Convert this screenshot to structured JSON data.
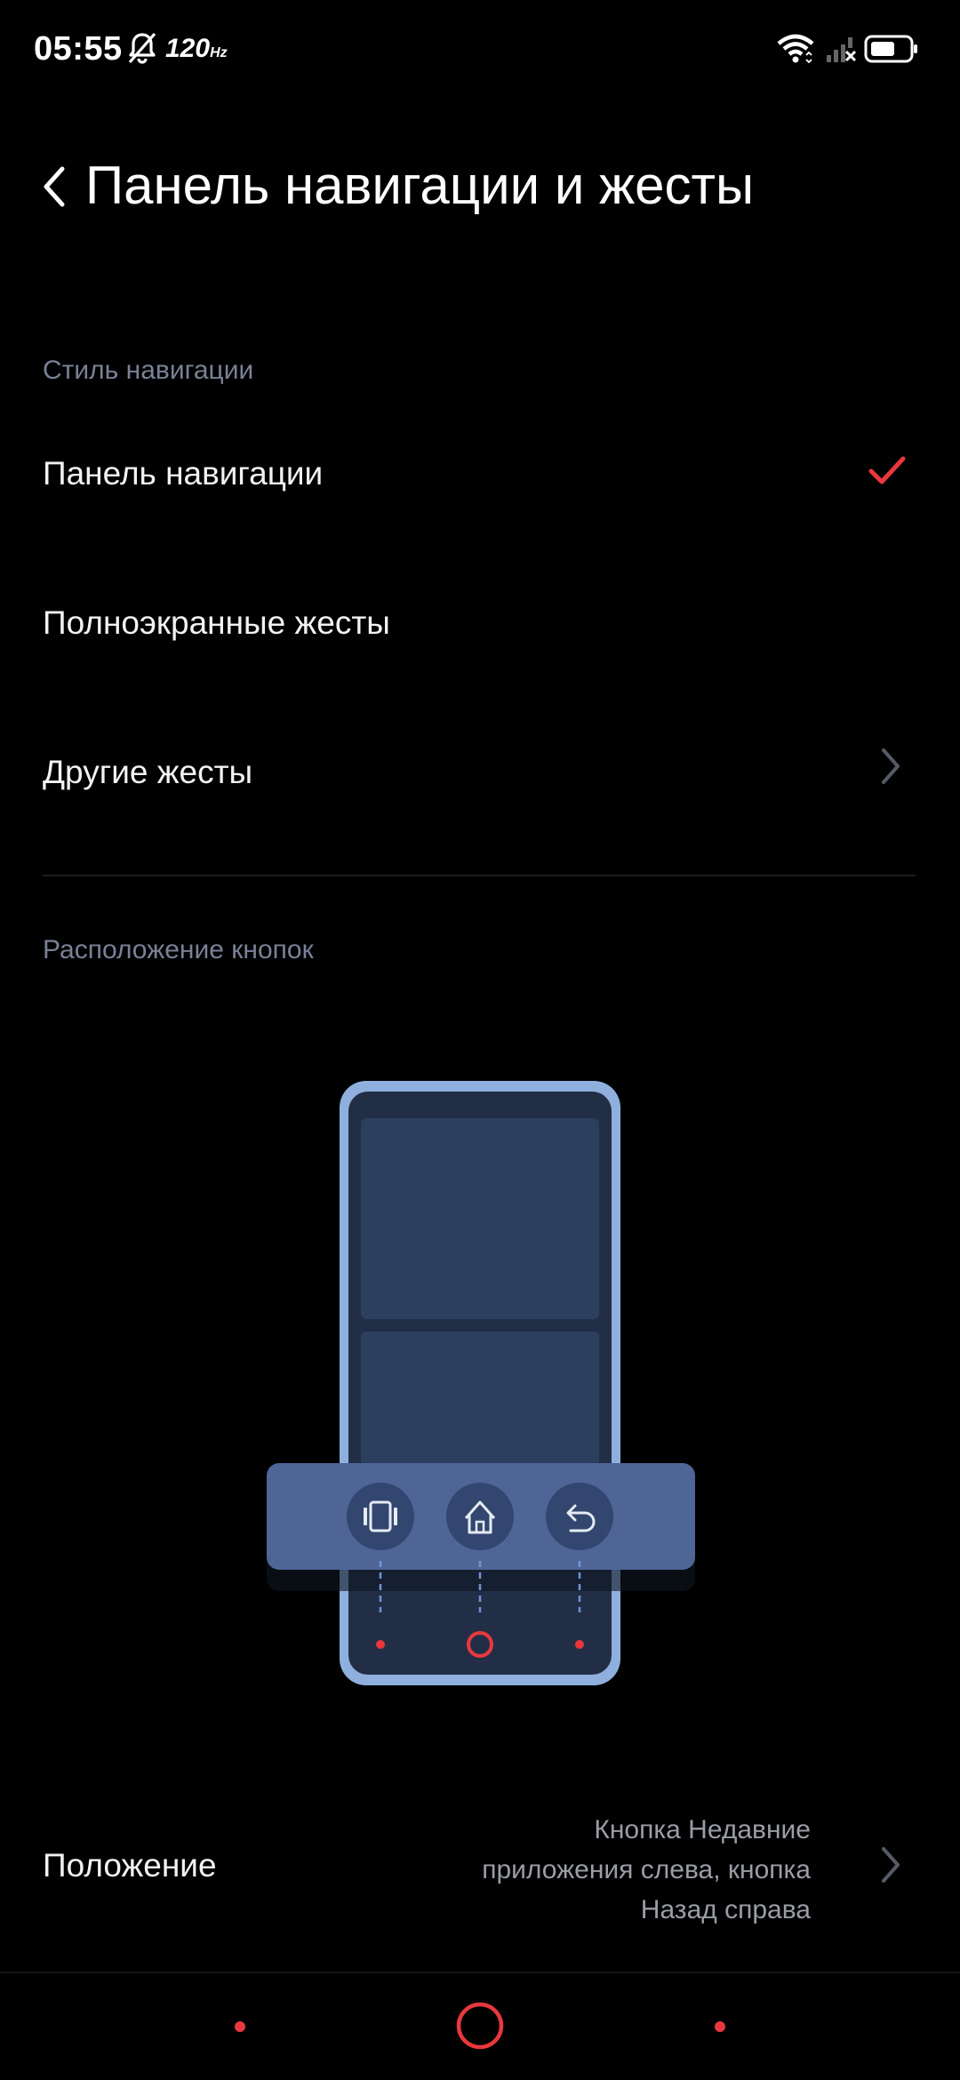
{
  "status_bar": {
    "time": "05:55",
    "refresh_rate": "120",
    "refresh_unit": "Hz",
    "icons": [
      "bell-off-icon",
      "wifi-icon",
      "signal-no-service-icon",
      "battery-icon"
    ]
  },
  "header": {
    "title": "Панель навигации и жесты",
    "back_icon": "chevron-left-icon"
  },
  "nav_style": {
    "section_label": "Стиль навигации",
    "items": [
      {
        "label": "Панель навигации",
        "selected": true,
        "trailing_icon": "check-icon"
      },
      {
        "label": "Полноэкранные жесты",
        "selected": false
      },
      {
        "label": "Другие жесты",
        "trailing_icon": "chevron-right-icon"
      }
    ]
  },
  "buttons_layout": {
    "section_label": "Расположение кнопок",
    "illustration_buttons": [
      "recents-icon",
      "home-icon",
      "back-icon"
    ]
  },
  "position": {
    "label": "Положение",
    "value_lines": [
      "Кнопка Недавние",
      "приложения слева, кнопка",
      "Назад справа"
    ]
  },
  "colors": {
    "background": "#000000",
    "accent": "#e8383d",
    "secondary_text": "#7a8196",
    "value_text": "#9a9da6",
    "illustration_frame": "#8fb0df",
    "illustration_bar": "#4e6596"
  }
}
